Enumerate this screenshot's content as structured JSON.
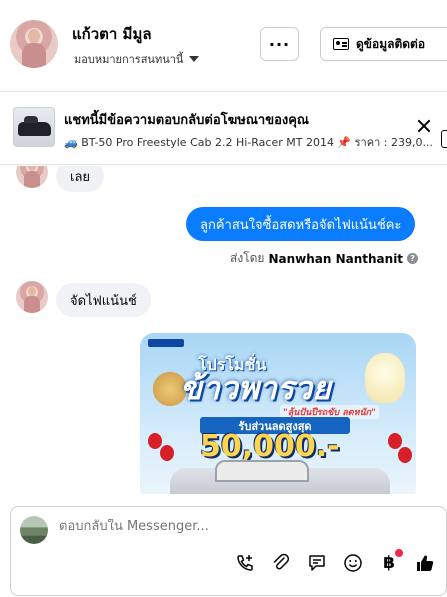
{
  "header": {
    "name": "แก้วตา มีมูล",
    "assign_label": "มอบหมายการสนทนานี้",
    "more_label": "···",
    "contact_label": "ดูข้อมูลติดต่อ"
  },
  "ad": {
    "title": "แชทนี้มีข้อความตอบกลับต่อโฆษณาของคุณ",
    "subtitle": "🚙 BT-50 Pro Freestyle Cab 2.2 Hi-Racer MT 2014 📌 ราคา : 239,0..."
  },
  "messages": {
    "in1": "เลย",
    "out1": "ลูกค้าสนใจซื้อสดหรือจัดไฟแน้นช์คะ",
    "sent_by_prefix": "ส่งโดย",
    "sent_by_name": "Nanwhan Nanthanit",
    "in2": "จัดไฟแน้นช์"
  },
  "promo": {
    "line1": "โปรโมชั่น",
    "line2": "ข้าวพารวย",
    "tag": "\"ลุ้นปันปีรถขับ ลดหนัก\"",
    "band": "รับส่วนลดสูงสุด",
    "amount": "50,000.-"
  },
  "composer": {
    "placeholder": "ตอบกลับใน Messenger..."
  },
  "icons": [
    "caret-down-icon",
    "contact-card-icon",
    "close-icon",
    "help-icon",
    "call-add-icon",
    "attachment-icon",
    "chat-bubble-icon",
    "emoji-icon",
    "baht-icon",
    "thumbs-up-icon"
  ],
  "colors": {
    "accent": "#0a7cff",
    "notification": "#f02849"
  }
}
